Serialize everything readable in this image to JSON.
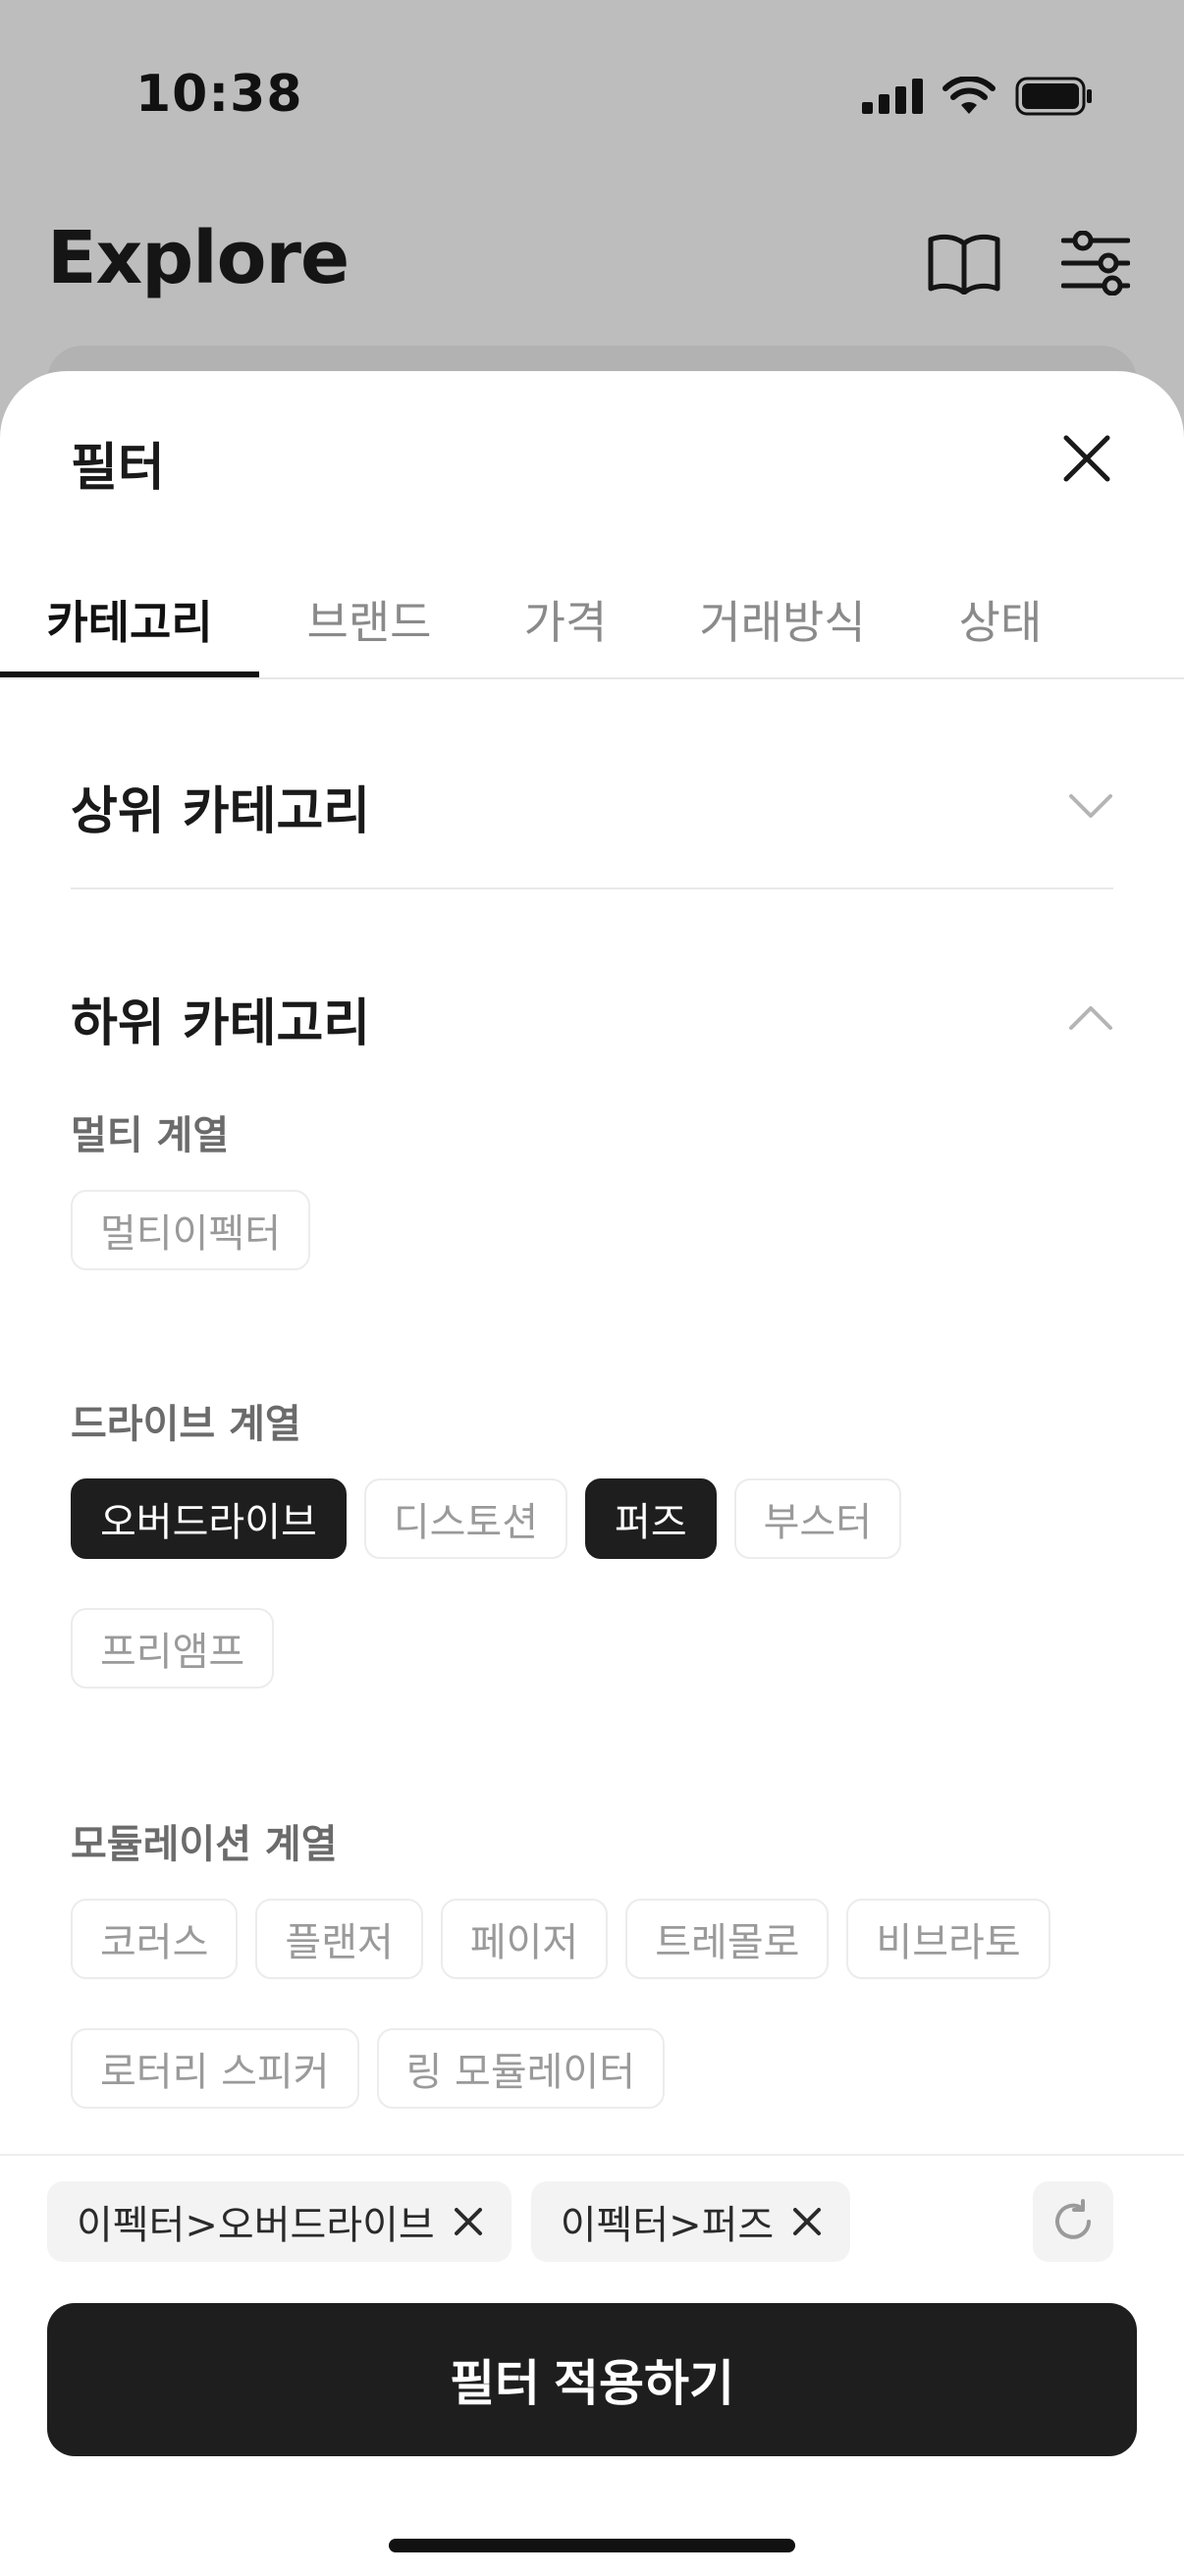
{
  "status_bar": {
    "time": "10:38"
  },
  "app": {
    "title": "Explore"
  },
  "sheet": {
    "title": "필터",
    "tabs": [
      {
        "label": "카테고리",
        "active": true
      },
      {
        "label": "브랜드",
        "active": false
      },
      {
        "label": "가격",
        "active": false
      },
      {
        "label": "거래방식",
        "active": false
      },
      {
        "label": "상태",
        "active": false
      }
    ],
    "sections": {
      "upper": {
        "title": "상위 카테고리",
        "expanded": false
      },
      "lower": {
        "title": "하위 카테고리",
        "expanded": true
      }
    },
    "groups": {
      "multi": {
        "label": "멀티 계열",
        "chips": [
          {
            "label": "멀티이펙터",
            "selected": false
          }
        ]
      },
      "drive": {
        "label": "드라이브 계열",
        "chips": [
          {
            "label": "오버드라이브",
            "selected": true
          },
          {
            "label": "디스토션",
            "selected": false
          },
          {
            "label": "퍼즈",
            "selected": true
          },
          {
            "label": "부스터",
            "selected": false
          },
          {
            "label": "프리앰프",
            "selected": false
          }
        ]
      },
      "modulation": {
        "label": "모듈레이션 계열",
        "chips": [
          {
            "label": "코러스",
            "selected": false
          },
          {
            "label": "플랜저",
            "selected": false
          },
          {
            "label": "페이저",
            "selected": false
          },
          {
            "label": "트레몰로",
            "selected": false
          },
          {
            "label": "비브라토",
            "selected": false
          },
          {
            "label": "로터리 스피커",
            "selected": false
          },
          {
            "label": "링 모듈레이터",
            "selected": false
          }
        ]
      }
    },
    "selected_tags": [
      {
        "label": "이펙터>오버드라이브"
      },
      {
        "label": "이펙터>퍼즈"
      }
    ],
    "apply_label": "필터 적용하기"
  },
  "icons": {
    "book": "book-icon",
    "filter": "sliders-icon",
    "close": "close-icon",
    "chevron_down": "chevron-down-icon",
    "chevron_up": "chevron-up-icon",
    "remove": "x-icon",
    "reset": "refresh-icon"
  },
  "colors": {
    "dim_background": "#bdbdbd",
    "sheet_background": "#ffffff",
    "selected_chip": "#1e1e1e",
    "apply_button": "#1e1e1e"
  }
}
